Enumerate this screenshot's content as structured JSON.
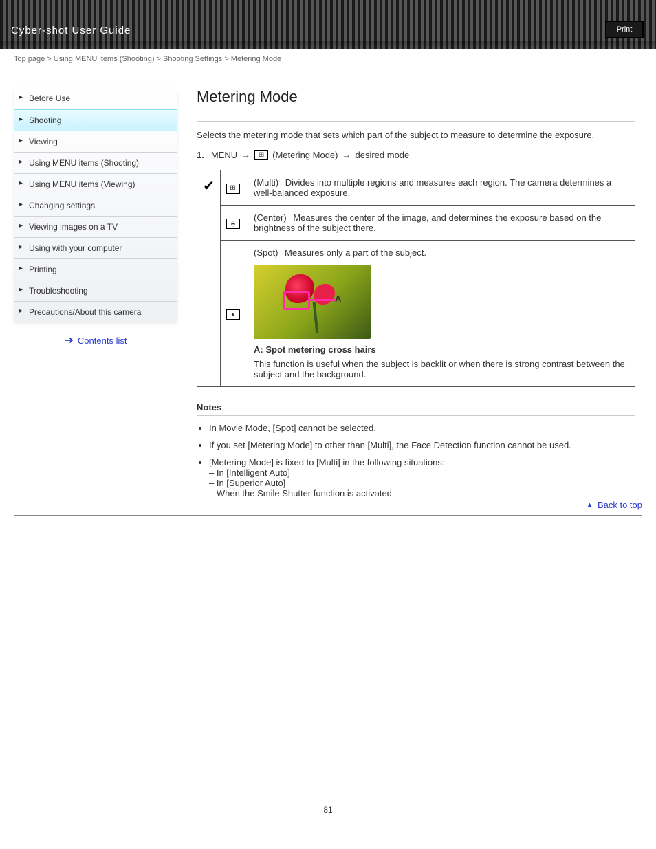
{
  "header": {
    "title_prefix": "Cyber-shot User Guide",
    "search_label": "Print"
  },
  "sidebar": {
    "items": [
      {
        "label": "Before Use"
      },
      {
        "label": "Shooting"
      },
      {
        "label": "Viewing"
      },
      {
        "label": "Using MENU items (Shooting)"
      },
      {
        "label": "Using MENU items (Viewing)"
      },
      {
        "label": "Changing settings"
      },
      {
        "label": "Viewing images on a TV"
      },
      {
        "label": "Using with your computer"
      },
      {
        "label": "Printing"
      },
      {
        "label": "Troubleshooting"
      },
      {
        "label": "Precautions/About this camera"
      }
    ],
    "back": "Contents list"
  },
  "breadcrumb": "Top page > Using MENU items (Shooting) > Shooting Settings > Metering Mode",
  "main": {
    "title": "Metering Mode",
    "lead": "Selects the metering mode that sets which part of the subject to measure to determine the exposure.",
    "step_num": "1.",
    "step_a": "MENU",
    "step_b": "(Metering Mode)",
    "step_c": "desired mode",
    "rows": [
      {
        "icon": "multi",
        "label": "(Multi)",
        "desc": "Divides into multiple regions and measures each region. The camera determines a well-balanced exposure."
      },
      {
        "icon": "center",
        "label": "(Center)",
        "desc": "Measures the center of the image, and determines the exposure based on the brightness of the subject there."
      },
      {
        "icon": "spot",
        "label": "(Spot)",
        "desc_a": "Measures only a part of the subject.",
        "desc_b": "A: Spot metering cross hairs",
        "desc_c": "This function is useful when the subject is backlit or when there is strong contrast between the subject and the background.",
        "range_label": "A"
      }
    ],
    "notes_head": "Notes",
    "notes": [
      "In Movie Mode, [Spot] cannot be selected.",
      "If you set [Metering Mode] to other than [Multi], the Face Detection function cannot be used.",
      "[Metering Mode] is fixed to [Multi] in the following situations:\n– In [Intelligent Auto]\n– In [Superior Auto]\n– When the Smile Shutter function is activated"
    ]
  },
  "back_top": "Back to top",
  "page_number": "81"
}
